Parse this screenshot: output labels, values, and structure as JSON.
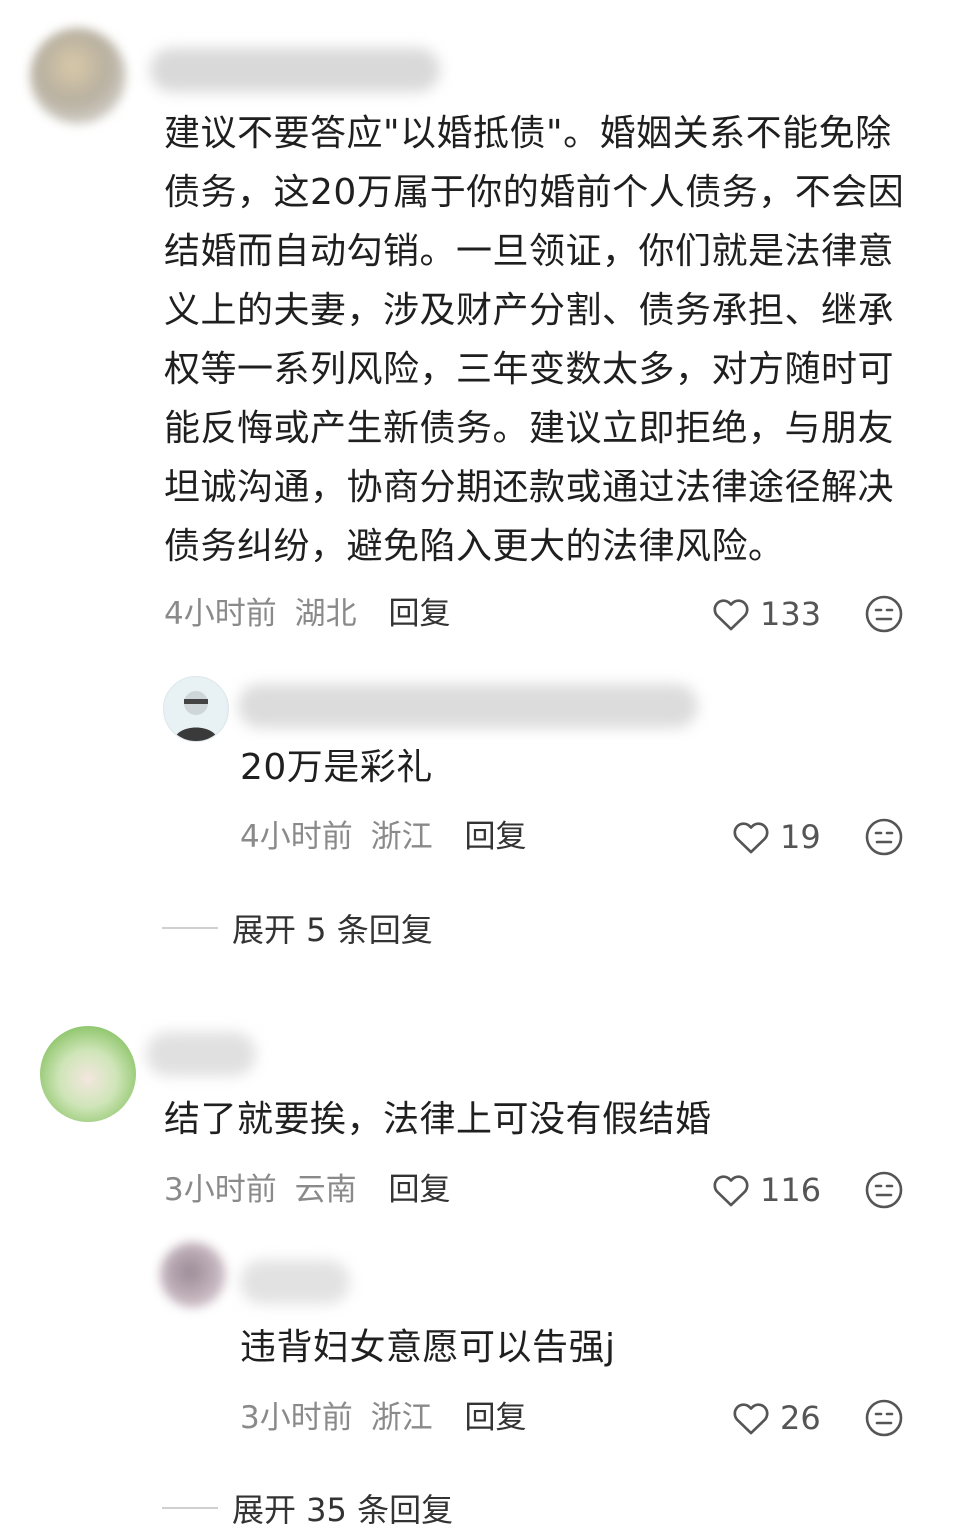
{
  "comments": [
    {
      "text": "建议不要答应\"以婚抵债\"。婚姻关系不能免除债务，这20万属于你的婚前个人债务，不会因结婚而自动勾销。一旦领证，你们就是法律意义上的夫妻，涉及财产分割、债务承担、继承权等一系列风险，三年变数太多，对方随时可能反悔或产生新债务。建议立即拒绝，与朋友坦诚沟通，协商分期还款或通过法律途径解决债务纠纷，避免陷入更大的法律风险。",
      "time": "4小时前",
      "region": "湖北",
      "reply_label": "回复",
      "likes": "133",
      "reply": {
        "text": "20万是彩礼",
        "time": "4小时前",
        "region": "浙江",
        "reply_label": "回复",
        "likes": "19"
      },
      "expand_label": "展开 5 条回复"
    },
    {
      "text": "结了就要挨，法律上可没有假结婚",
      "time": "3小时前",
      "region": "云南",
      "reply_label": "回复",
      "likes": "116",
      "reply": {
        "text": "违背妇女意愿可以告强j",
        "time": "3小时前",
        "region": "浙江",
        "reply_label": "回复",
        "likes": "26"
      },
      "expand_label": "展开 35 条回复"
    }
  ]
}
